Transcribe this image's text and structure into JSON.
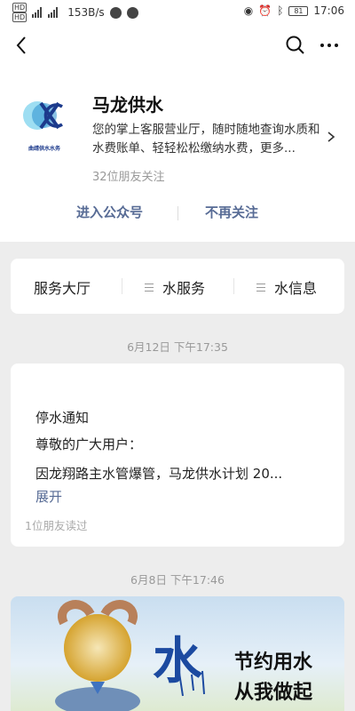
{
  "status_bar": {
    "speed": "153B/s",
    "battery": "81",
    "time": "17:06",
    "hd1": "HD",
    "hd2": "HD"
  },
  "account": {
    "logo_text": "曲靖供水水务",
    "name": "马龙供水",
    "description": "您的掌上客服营业厅，随时随地查询水质和水费账单、轻轻松松缴纳水费，更多...",
    "followers": "32位朋友关注"
  },
  "actions": {
    "enter": "进入公众号",
    "unfollow": "不再关注"
  },
  "menu": [
    {
      "label": "服务大厅"
    },
    {
      "label": "水服务"
    },
    {
      "label": "水信息"
    }
  ],
  "messages": [
    {
      "time": "6月12日 下午17:35",
      "title": "停水通知",
      "greeting": "尊敬的广大用户：",
      "body": "因龙翔路主水管爆管，马龙供水计划 20...",
      "expand": "展开",
      "reads": "1位朋友读过"
    },
    {
      "time": "6月8日 下午17:46",
      "image_glyph": "水",
      "image_line1": "节约用水",
      "image_line2": "从我做起"
    }
  ],
  "colors": {
    "link": "#576b95",
    "background": "#ededed",
    "logo_blue": "#1c3a8c"
  },
  "icons": [
    "back-icon",
    "search-icon",
    "more-icon",
    "chevron-right-icon",
    "menu-list-icon"
  ]
}
